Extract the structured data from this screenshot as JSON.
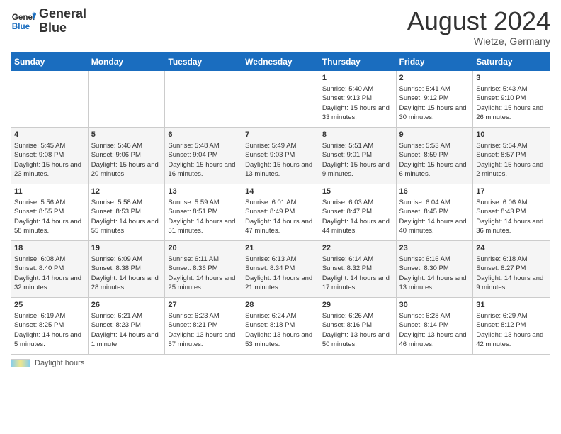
{
  "header": {
    "logo_general": "General",
    "logo_blue": "Blue",
    "month_year": "August 2024",
    "location": "Wietze, Germany"
  },
  "weekdays": [
    "Sunday",
    "Monday",
    "Tuesday",
    "Wednesday",
    "Thursday",
    "Friday",
    "Saturday"
  ],
  "weeks": [
    [
      {
        "day": "",
        "info": ""
      },
      {
        "day": "",
        "info": ""
      },
      {
        "day": "",
        "info": ""
      },
      {
        "day": "",
        "info": ""
      },
      {
        "day": "1",
        "info": "Sunrise: 5:40 AM\nSunset: 9:13 PM\nDaylight: 15 hours and 33 minutes."
      },
      {
        "day": "2",
        "info": "Sunrise: 5:41 AM\nSunset: 9:12 PM\nDaylight: 15 hours and 30 minutes."
      },
      {
        "day": "3",
        "info": "Sunrise: 5:43 AM\nSunset: 9:10 PM\nDaylight: 15 hours and 26 minutes."
      }
    ],
    [
      {
        "day": "4",
        "info": "Sunrise: 5:45 AM\nSunset: 9:08 PM\nDaylight: 15 hours and 23 minutes."
      },
      {
        "day": "5",
        "info": "Sunrise: 5:46 AM\nSunset: 9:06 PM\nDaylight: 15 hours and 20 minutes."
      },
      {
        "day": "6",
        "info": "Sunrise: 5:48 AM\nSunset: 9:04 PM\nDaylight: 15 hours and 16 minutes."
      },
      {
        "day": "7",
        "info": "Sunrise: 5:49 AM\nSunset: 9:03 PM\nDaylight: 15 hours and 13 minutes."
      },
      {
        "day": "8",
        "info": "Sunrise: 5:51 AM\nSunset: 9:01 PM\nDaylight: 15 hours and 9 minutes."
      },
      {
        "day": "9",
        "info": "Sunrise: 5:53 AM\nSunset: 8:59 PM\nDaylight: 15 hours and 6 minutes."
      },
      {
        "day": "10",
        "info": "Sunrise: 5:54 AM\nSunset: 8:57 PM\nDaylight: 15 hours and 2 minutes."
      }
    ],
    [
      {
        "day": "11",
        "info": "Sunrise: 5:56 AM\nSunset: 8:55 PM\nDaylight: 14 hours and 58 minutes."
      },
      {
        "day": "12",
        "info": "Sunrise: 5:58 AM\nSunset: 8:53 PM\nDaylight: 14 hours and 55 minutes."
      },
      {
        "day": "13",
        "info": "Sunrise: 5:59 AM\nSunset: 8:51 PM\nDaylight: 14 hours and 51 minutes."
      },
      {
        "day": "14",
        "info": "Sunrise: 6:01 AM\nSunset: 8:49 PM\nDaylight: 14 hours and 47 minutes."
      },
      {
        "day": "15",
        "info": "Sunrise: 6:03 AM\nSunset: 8:47 PM\nDaylight: 14 hours and 44 minutes."
      },
      {
        "day": "16",
        "info": "Sunrise: 6:04 AM\nSunset: 8:45 PM\nDaylight: 14 hours and 40 minutes."
      },
      {
        "day": "17",
        "info": "Sunrise: 6:06 AM\nSunset: 8:43 PM\nDaylight: 14 hours and 36 minutes."
      }
    ],
    [
      {
        "day": "18",
        "info": "Sunrise: 6:08 AM\nSunset: 8:40 PM\nDaylight: 14 hours and 32 minutes."
      },
      {
        "day": "19",
        "info": "Sunrise: 6:09 AM\nSunset: 8:38 PM\nDaylight: 14 hours and 28 minutes."
      },
      {
        "day": "20",
        "info": "Sunrise: 6:11 AM\nSunset: 8:36 PM\nDaylight: 14 hours and 25 minutes."
      },
      {
        "day": "21",
        "info": "Sunrise: 6:13 AM\nSunset: 8:34 PM\nDaylight: 14 hours and 21 minutes."
      },
      {
        "day": "22",
        "info": "Sunrise: 6:14 AM\nSunset: 8:32 PM\nDaylight: 14 hours and 17 minutes."
      },
      {
        "day": "23",
        "info": "Sunrise: 6:16 AM\nSunset: 8:30 PM\nDaylight: 14 hours and 13 minutes."
      },
      {
        "day": "24",
        "info": "Sunrise: 6:18 AM\nSunset: 8:27 PM\nDaylight: 14 hours and 9 minutes."
      }
    ],
    [
      {
        "day": "25",
        "info": "Sunrise: 6:19 AM\nSunset: 8:25 PM\nDaylight: 14 hours and 5 minutes."
      },
      {
        "day": "26",
        "info": "Sunrise: 6:21 AM\nSunset: 8:23 PM\nDaylight: 14 hours and 1 minute."
      },
      {
        "day": "27",
        "info": "Sunrise: 6:23 AM\nSunset: 8:21 PM\nDaylight: 13 hours and 57 minutes."
      },
      {
        "day": "28",
        "info": "Sunrise: 6:24 AM\nSunset: 8:18 PM\nDaylight: 13 hours and 53 minutes."
      },
      {
        "day": "29",
        "info": "Sunrise: 6:26 AM\nSunset: 8:16 PM\nDaylight: 13 hours and 50 minutes."
      },
      {
        "day": "30",
        "info": "Sunrise: 6:28 AM\nSunset: 8:14 PM\nDaylight: 13 hours and 46 minutes."
      },
      {
        "day": "31",
        "info": "Sunrise: 6:29 AM\nSunset: 8:12 PM\nDaylight: 13 hours and 42 minutes."
      }
    ]
  ],
  "legend": {
    "label": "Daylight hours"
  }
}
